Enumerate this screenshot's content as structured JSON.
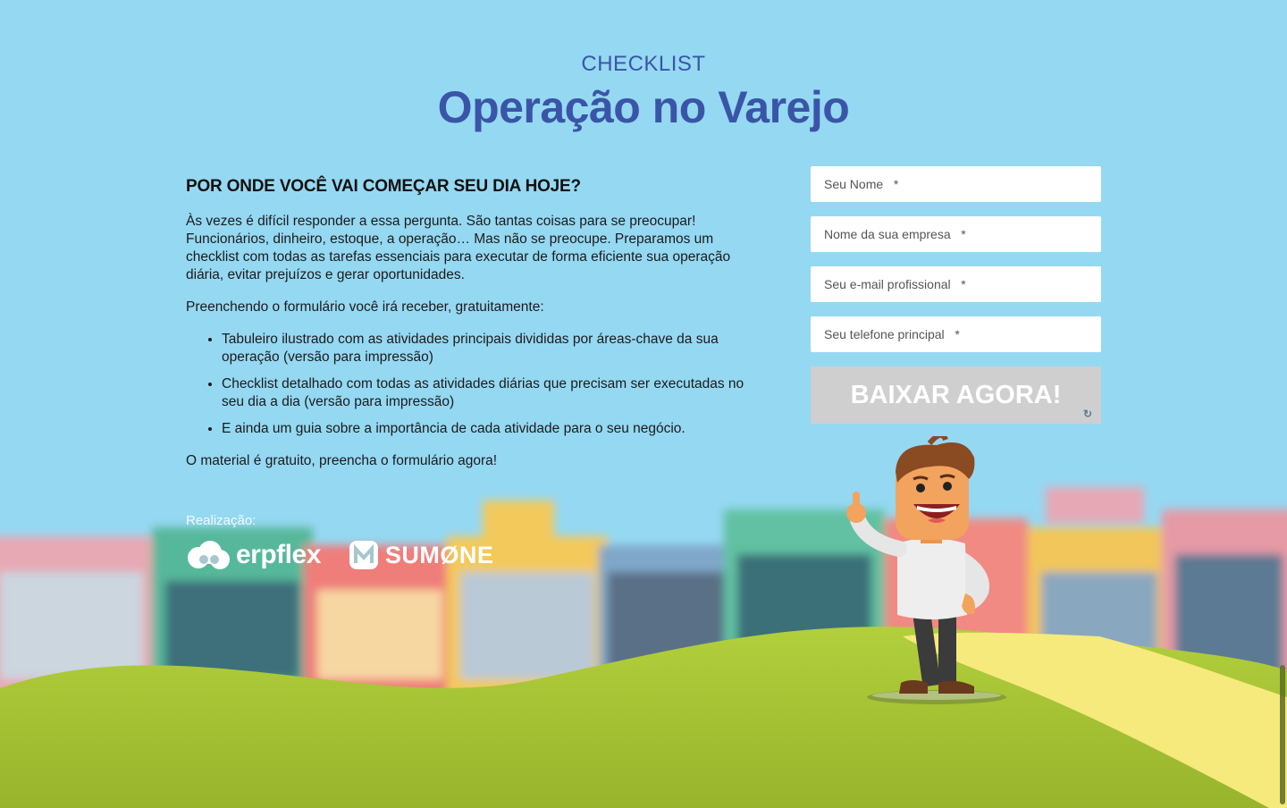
{
  "header": {
    "eyebrow": "CHECKLIST",
    "title": "Operação no Varejo"
  },
  "intro": {
    "heading": "POR ONDE VOCÊ VAI COMEÇAR SEU DIA HOJE?",
    "paragraph1": "Às vezes é difícil responder a essa pergunta. São tantas coisas para se preocupar! Funcionários, dinheiro, estoque, a operação… Mas não se preocupe. Preparamos um checklist com todas as tarefas essenciais para executar de forma eficiente sua operação diária, evitar prejuízos e gerar oportunidades.",
    "paragraph2": "Preenchendo o formulário você irá receber, gratuitamente:",
    "benefits": [
      "Tabuleiro ilustrado com as atividades principais divididas por áreas-chave da sua operação (versão para impressão)",
      "Checklist detalhado com todas as atividades diárias que precisam ser executadas no seu dia a dia (versão para impressão)",
      "E ainda um guia sobre a importância de cada atividade para o seu negócio."
    ],
    "closing": "O material é gratuito, preencha o formulário agora!"
  },
  "realizacao": {
    "label": "Realização:",
    "logo1": "erpflex",
    "logo2": "SUMØNE"
  },
  "form": {
    "name_placeholder": "Seu Nome   *",
    "company_placeholder": "Nome da sua empresa   *",
    "email_placeholder": "Seu e-mail profissional   *",
    "phone_placeholder": "Seu telefone principal   *",
    "submit_label": "BAIXAR AGORA!",
    "captcha_icon": "recaptcha-icon"
  },
  "colors": {
    "sky": "#95d8f2",
    "title": "#3a55a7",
    "grass": "#a9c93a",
    "path": "#f6ea7c",
    "button": "#cfcfcf"
  }
}
